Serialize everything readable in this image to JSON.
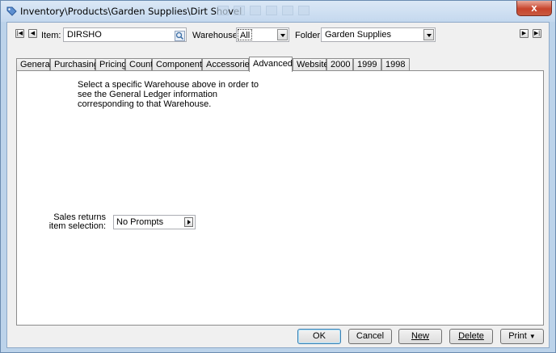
{
  "window": {
    "title": "Inventory\\Products\\Garden Supplies\\Dirt Shovel",
    "close_label": "x"
  },
  "header": {
    "item_label": "Item:",
    "item_value": "DIRSHO",
    "warehouse_label": "Warehouse:",
    "warehouse_value": "All",
    "folder_label": "Folder:",
    "folder_value": "Garden Supplies"
  },
  "tabs": [
    {
      "label": "General"
    },
    {
      "label": "Purchasing"
    },
    {
      "label": "Pricing"
    },
    {
      "label": "Count"
    },
    {
      "label": "Components"
    },
    {
      "label": "Accessories"
    },
    {
      "label": "Advanced",
      "active": true
    },
    {
      "label": "Website"
    },
    {
      "label": "2000"
    },
    {
      "label": "1999"
    },
    {
      "label": "1998"
    }
  ],
  "panel": {
    "message": "Select a specific Warehouse above in order to see the General Ledger information corresponding to that Warehouse.",
    "sales_returns_label_1": "Sales returns",
    "sales_returns_label_2": "item selection:",
    "sales_returns_value": "No Prompts"
  },
  "buttons": {
    "ok": "OK",
    "cancel": "Cancel",
    "new": "New",
    "delete": "Delete",
    "print": "Print"
  }
}
